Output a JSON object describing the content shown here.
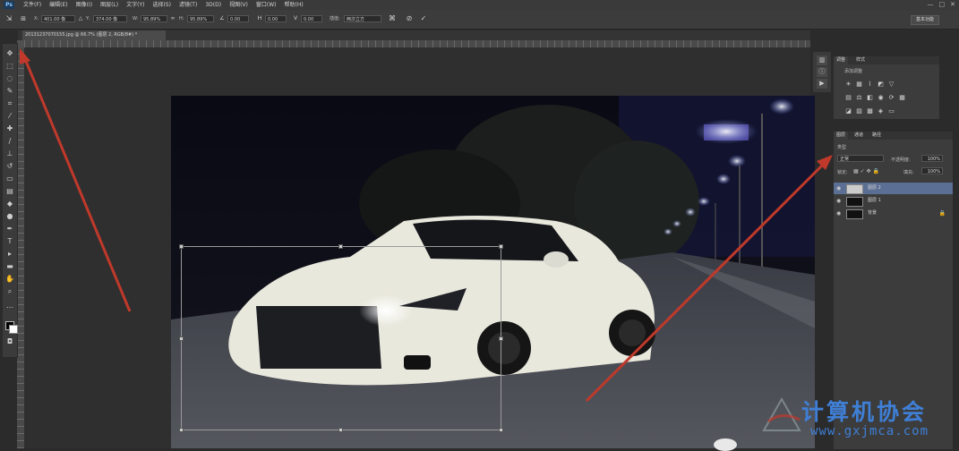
{
  "app": {
    "logo_text": "Ps"
  },
  "menubar": {
    "items": [
      "文件(F)",
      "编辑(E)",
      "图像(I)",
      "图层(L)",
      "文字(Y)",
      "选择(S)",
      "滤镜(T)",
      "3D(D)",
      "视图(V)",
      "窗口(W)",
      "帮助(H)"
    ],
    "window_controls": [
      "—",
      "□",
      "✕"
    ]
  },
  "optionsbar": {
    "x_label": "X:",
    "x_value": "401.00 像",
    "y_label": "Y:",
    "y_value": "374.00 像",
    "w_label": "W:",
    "w_value": "95.89%",
    "h_label": "H:",
    "h_value": "95.89%",
    "angle_value": "0.00",
    "h_skew_value": "0.00",
    "v_skew_value": "0.00",
    "interp_label": "插值:",
    "interp_value": "两次立方",
    "cancel_glyph": "⊘",
    "commit_glyph": "✓",
    "essentials": "基本功能"
  },
  "document": {
    "tab_label": "20131237070155.jpg @ 66.7% (图层 2, RGB/8#) *"
  },
  "panels": {
    "adjustments": {
      "tab_active": "调整",
      "tab_other": "样式",
      "title": "添加调整"
    },
    "layers": {
      "tabs": [
        "图层",
        "通道",
        "路径"
      ],
      "kind_label": "类型",
      "blend_mode": "正常",
      "opacity_label": "不透明度:",
      "opacity_value": "100%",
      "lock_label": "锁定:",
      "fill_label": "填充:",
      "fill_value": "100%",
      "layers": [
        {
          "name": "图层 2",
          "selected": true
        },
        {
          "name": "图层 1",
          "selected": false
        },
        {
          "name": "背景",
          "selected": false
        }
      ]
    }
  },
  "watermark": {
    "title": "计算机协会",
    "url": "www.gxjmca.com"
  },
  "colors": {
    "arrow": "#c0392b",
    "watermark": "#3f7fd6",
    "selected_layer": "#5b6e93"
  }
}
